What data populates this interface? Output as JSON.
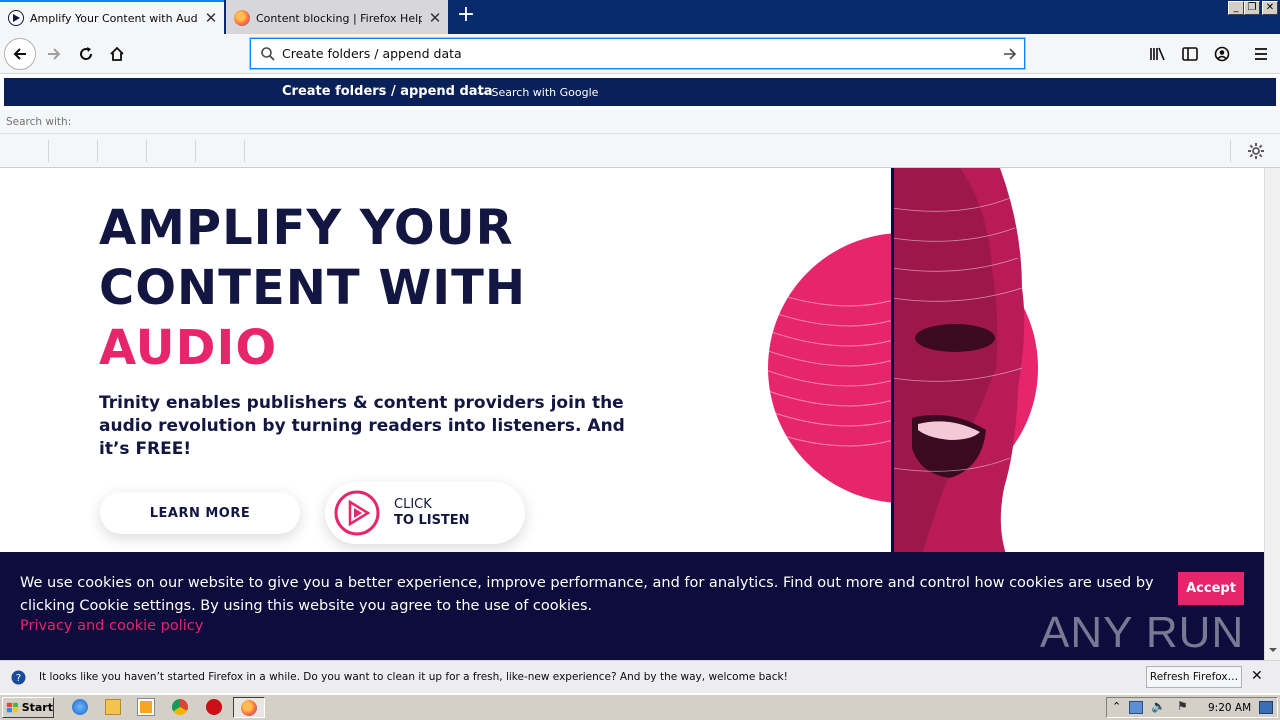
{
  "browser": {
    "tabs": [
      {
        "title": "Amplify Your Content with Audio |",
        "active": true
      },
      {
        "title": "Content blocking | Firefox Help",
        "active": false
      }
    ],
    "new_tab_label": "+",
    "url_value": "Create folders / append data"
  },
  "autocomplete": {
    "query": "Create folders / append data",
    "separator_hint": "— Search with Google",
    "search_with_label": "Search with:"
  },
  "hero": {
    "title_line1": "AMPLIFY YOUR",
    "title_line2": "CONTENT WITH",
    "title_line3": "AUDIO",
    "description": "Trinity enables publishers & content providers join the audio revolution by turning readers into listeners. And it’s FREE!",
    "learn_more": "LEARN MORE",
    "listen_line1": "CLICK",
    "listen_line2": "TO LISTEN"
  },
  "cookie_banner": {
    "text": "We use cookies on our website to give you a better experience, improve performance, and for analytics. Find out more and control how cookies are used by clicking Cookie settings. By using this website you agree to the use of cookies.",
    "link": "Privacy and cookie policy",
    "accept": "Accept",
    "watermark": "ANY RUN"
  },
  "notification": {
    "text": "It looks like you haven’t started Firefox in a while. Do you want to clean it up for a fresh, like-new experience? And by the way, welcome back!",
    "button": "Refresh Firefox…"
  },
  "taskbar": {
    "start": "Start",
    "clock": "9:20 AM"
  },
  "colors": {
    "accent_pink": "#e7256b",
    "navy": "#121640",
    "banner_bg": "#0e0c3c"
  }
}
